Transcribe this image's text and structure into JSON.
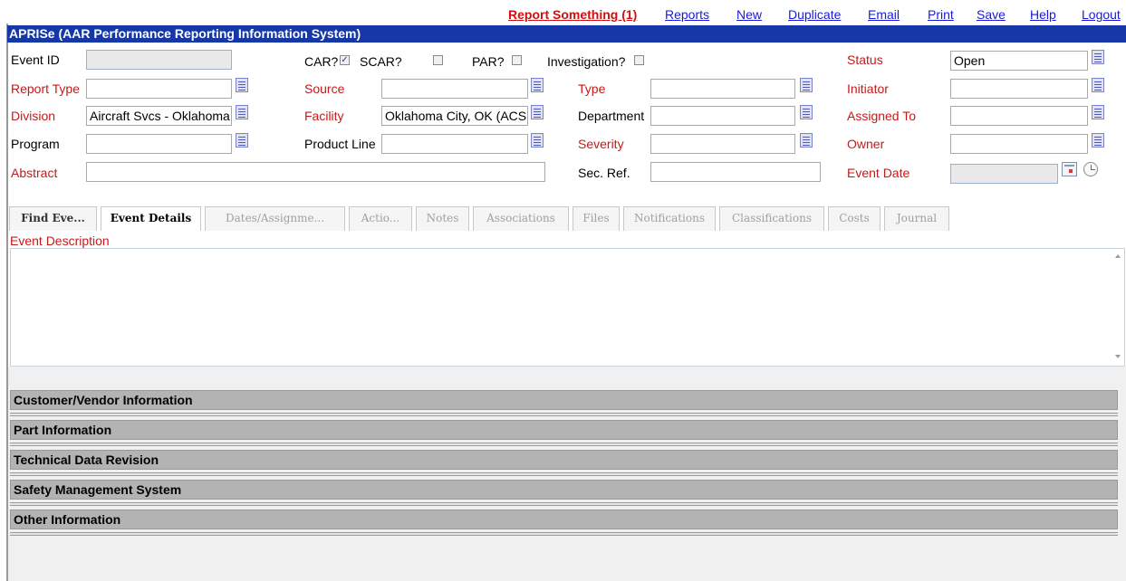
{
  "toplinks": {
    "report_something": "Report Something (1)",
    "reports": "Reports",
    "new": "New",
    "duplicate": "Duplicate",
    "email": "Email",
    "print": "Print",
    "save": "Save",
    "help": "Help",
    "logout": "Logout"
  },
  "app": {
    "title": "APRISe (AAR Performance Reporting Information System)"
  },
  "form": {
    "event_id": {
      "label": "Event ID",
      "value": ""
    },
    "car": {
      "label": "CAR?",
      "checked": true
    },
    "scar": {
      "label": "SCAR?",
      "checked": false
    },
    "par": {
      "label": "PAR?",
      "checked": false
    },
    "investigation": {
      "label": "Investigation?",
      "checked": false
    },
    "status": {
      "label": "Status",
      "value": "Open"
    },
    "report_type": {
      "label": "Report Type",
      "value": ""
    },
    "source": {
      "label": "Source",
      "value": ""
    },
    "type": {
      "label": "Type",
      "value": ""
    },
    "initiator": {
      "label": "Initiator",
      "value": ""
    },
    "division": {
      "label": "Division",
      "value": "Aircraft Svcs - Oklahoma"
    },
    "facility": {
      "label": "Facility",
      "value": "Oklahoma City, OK (ACS"
    },
    "department": {
      "label": "Department",
      "value": ""
    },
    "assigned_to": {
      "label": "Assigned To",
      "value": ""
    },
    "program": {
      "label": "Program",
      "value": ""
    },
    "product_line": {
      "label": "Product Line",
      "value": ""
    },
    "severity": {
      "label": "Severity",
      "value": ""
    },
    "owner": {
      "label": "Owner",
      "value": ""
    },
    "abstract": {
      "label": "Abstract",
      "value": ""
    },
    "sec_ref": {
      "label": "Sec. Ref.",
      "value": ""
    },
    "event_date": {
      "label": "Event Date",
      "value": ""
    }
  },
  "tabs": [
    {
      "label": "Find Eve...",
      "state": "dark"
    },
    {
      "label": "Event Details",
      "state": "active"
    },
    {
      "label": "Dates/Assignme...",
      "state": "disabled"
    },
    {
      "label": "Actio...",
      "state": "disabled"
    },
    {
      "label": "Notes",
      "state": "disabled"
    },
    {
      "label": "Associations",
      "state": "disabled"
    },
    {
      "label": "Files",
      "state": "disabled"
    },
    {
      "label": "Notifications",
      "state": "disabled"
    },
    {
      "label": "Classifications",
      "state": "disabled"
    },
    {
      "label": "Costs",
      "state": "disabled"
    },
    {
      "label": "Journal",
      "state": "disabled"
    }
  ],
  "event_description": {
    "label": "Event Description",
    "value": ""
  },
  "sections": [
    "Customer/Vendor Information",
    "Part Information",
    "Technical Data Revision",
    "Safety Management System",
    "Other Information"
  ],
  "colors": {
    "title_bar": "#1538a6",
    "required_label": "#c41a1a",
    "link": "#1a1ad8",
    "section_bg": "#b3b3b3"
  }
}
